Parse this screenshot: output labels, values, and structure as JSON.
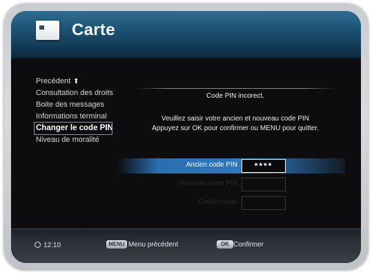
{
  "header": {
    "title": "Carte",
    "icon": "smart-card-icon"
  },
  "menu": {
    "items": [
      {
        "label": "Precédent"
      },
      {
        "label": "Consultation des droits"
      },
      {
        "label": "Boite des messages"
      },
      {
        "label": "Informations terminal"
      },
      {
        "label": "Changer le code PIN"
      },
      {
        "label": "Niveau de moralité"
      }
    ],
    "selected_index": 4,
    "back_icon": "up-arrow-icon"
  },
  "panel": {
    "status_message": "Code PIN incorect.",
    "instruction_1": "Veuillez saisir votre ancien et nouveau code PIN",
    "instruction_2": "Appuyez sur OK pour confirmer ou MENU pour quitter.",
    "fields": [
      {
        "label": "Ancien code PIN",
        "value": "****",
        "active": true
      },
      {
        "label": "Nouveau code PIN",
        "value": "",
        "active": false
      },
      {
        "label": "Confirmation",
        "value": "",
        "active": false
      }
    ]
  },
  "footer": {
    "time": "12:10",
    "menu_key": "MENU",
    "menu_label": "Menu précédent",
    "ok_key": "OK",
    "ok_label": "Confirmer"
  },
  "colors": {
    "header_blue": "#1d5272",
    "highlight_blue": "#2f79be",
    "background": "#0d0d0f"
  }
}
